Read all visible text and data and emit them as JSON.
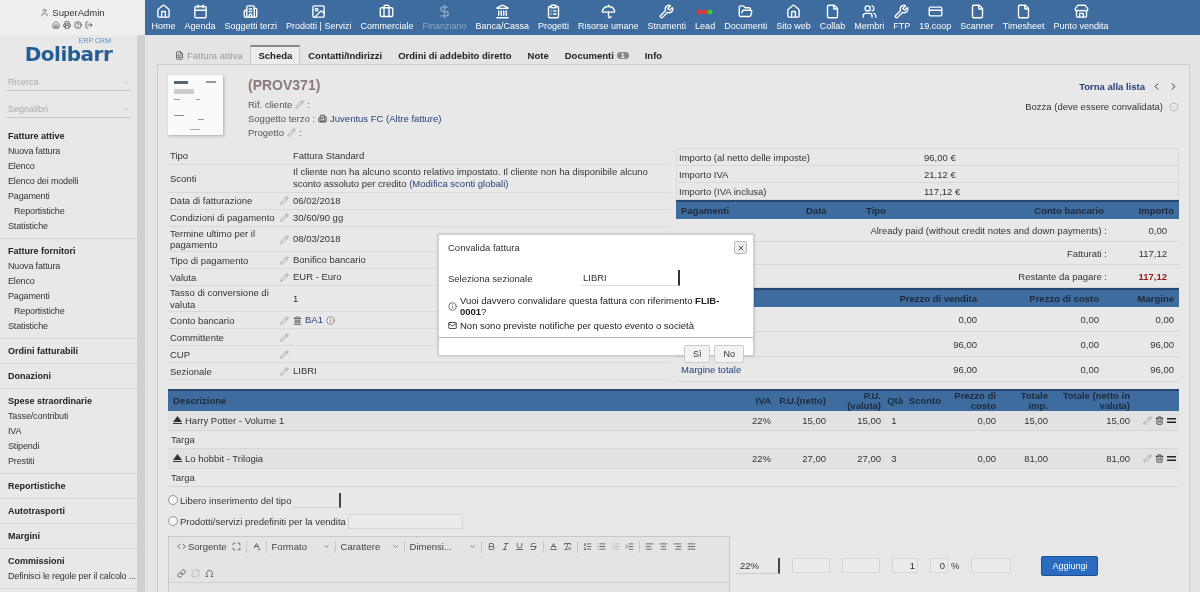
{
  "user": {
    "name": "SuperAdmin"
  },
  "nav": [
    {
      "label": "Home",
      "disabled": false
    },
    {
      "label": "Agenda",
      "disabled": false
    },
    {
      "label": "Soggetti terzi",
      "disabled": false
    },
    {
      "label": "Prodotti | Servizi",
      "disabled": false
    },
    {
      "label": "Commerciale",
      "disabled": false
    },
    {
      "label": "Finanziario",
      "disabled": true
    },
    {
      "label": "Banca/Cassa",
      "disabled": false
    },
    {
      "label": "Progetti",
      "disabled": false
    },
    {
      "label": "Risorse umane",
      "disabled": false
    },
    {
      "label": "Strumenti",
      "disabled": false
    },
    {
      "label": "Lead",
      "disabled": false
    },
    {
      "label": "Documenti",
      "disabled": false
    },
    {
      "label": "Sito web",
      "disabled": false
    },
    {
      "label": "Collab",
      "disabled": false
    },
    {
      "label": "Membri",
      "disabled": false
    },
    {
      "label": "FTP",
      "disabled": false
    },
    {
      "label": "19.coop",
      "disabled": false
    },
    {
      "label": "Scanner",
      "disabled": false
    },
    {
      "label": "Timesheet",
      "disabled": false
    },
    {
      "label": "Punto vendita",
      "disabled": false
    }
  ],
  "logo": {
    "name": "Dolibarr",
    "tagline": "ERP CRM"
  },
  "search": {
    "placeholder": "Ricerca"
  },
  "bookmarks": {
    "placeholder": "Segnalibri"
  },
  "menu": [
    {
      "title": "Fatture attive",
      "items": [
        {
          "label": "Nuova fattura"
        },
        {
          "label": "Elenco"
        },
        {
          "label": "Elenco dei modelli"
        },
        {
          "label": "Pagamenti",
          "children": [
            {
              "label": "Reportistiche"
            }
          ]
        },
        {
          "label": "Statistiche"
        }
      ]
    },
    {
      "title": "Fatture fornitori",
      "items": [
        {
          "label": "Nuova fattura"
        },
        {
          "label": "Elenco"
        },
        {
          "label": "Pagamenti",
          "children": [
            {
              "label": "Reportistiche"
            }
          ]
        },
        {
          "label": "Statistiche"
        }
      ]
    },
    {
      "title": "Ordini fatturabili"
    },
    {
      "title": "Donazioni"
    },
    {
      "title": "Spese straordinarie",
      "items": [
        {
          "label": "Tasse/contributi"
        },
        {
          "label": "IVA"
        },
        {
          "label": "Stipendi"
        },
        {
          "label": "Prestiti"
        }
      ]
    },
    {
      "title": "Reportistiche"
    },
    {
      "title": "Autotrasporti"
    },
    {
      "title": "Margini"
    },
    {
      "title": "Commissioni",
      "items": [
        {
          "label": "Definisci le regole per il calcolo ..."
        }
      ]
    }
  ],
  "tabs": [
    {
      "label": "Fattura attiva",
      "kind": "title",
      "selected": false
    },
    {
      "label": "Scheda",
      "kind": "tab",
      "selected": true
    },
    {
      "label": "Contatti/Indirizzi",
      "kind": "tab",
      "selected": false
    },
    {
      "label": "Ordini di addebito diretto",
      "kind": "tab",
      "selected": false
    },
    {
      "label": "Note",
      "kind": "tab",
      "selected": false
    },
    {
      "label": "Documenti",
      "kind": "tab",
      "selected": false,
      "badge": "1"
    },
    {
      "label": "Info",
      "kind": "tab",
      "selected": false
    }
  ],
  "invoice": {
    "ref": "(PROV371)",
    "fields": [
      {
        "label": "Rif. cliente",
        "editable": true,
        "suffix": ":"
      },
      {
        "label": "Soggetto terzo :",
        "editable": false,
        "link": "Juventus FC (Altre fatture)"
      },
      {
        "label": "Progetto",
        "editable": true,
        "suffix": ":"
      }
    ],
    "back_link": "Torna alla lista",
    "status": "Bozza (deve essere convalidata)"
  },
  "details": [
    {
      "label": "Tipo",
      "editable": false,
      "kind": "text",
      "value": "Fattura Standard"
    },
    {
      "label": "Sconti",
      "editable": false,
      "kind": "discount",
      "value": "Il cliente non ha alcuno sconto relativo impostato. Il cliente non ha disponibile alcuno sconto assoluto per credito",
      "link": "(Modifica sconti globali)"
    },
    {
      "label": "Data di fatturazione",
      "editable": true,
      "kind": "text",
      "value": "06/02/2018"
    },
    {
      "label": "Condizioni di pagamento",
      "editable": true,
      "kind": "text",
      "value": "30/60/90 gg"
    },
    {
      "label": "Termine ultimo per il pagamento",
      "editable": true,
      "kind": "text",
      "value": "08/03/2018"
    },
    {
      "label": "Tipo di pagamento",
      "editable": true,
      "kind": "text",
      "value": "Bonifico bancario"
    },
    {
      "label": "Valuta",
      "editable": true,
      "kind": "text",
      "value": "EUR - Euro"
    },
    {
      "label": "Tasso di conversione di valuta",
      "editable": false,
      "kind": "text",
      "value": "1"
    },
    {
      "label": "Conto bancario",
      "editable": true,
      "kind": "bank",
      "value": "BA1"
    },
    {
      "label": "Committente",
      "editable": true,
      "kind": "text"
    },
    {
      "label": "CUP",
      "editable": true,
      "kind": "text"
    },
    {
      "label": "Sezionale",
      "editable": true,
      "kind": "text",
      "value": "LIBRI"
    }
  ],
  "amounts": [
    {
      "label": "Importo (al netto delle imposte)",
      "value": "96,00 €"
    },
    {
      "label": "Importo IVA",
      "value": "21,12 €"
    },
    {
      "label": "Importo (IVA inclusa)",
      "value": "117,12 €"
    }
  ],
  "payments": {
    "columns": [
      "Pagamenti",
      "Data",
      "Tipo",
      "Conto bancario",
      "Importo"
    ],
    "rows": [
      {
        "label": "Already paid (without credit notes and down payments) :",
        "value": "0,00",
        "emphasis": false
      },
      {
        "label": "Fatturati :",
        "value": "117,12",
        "emphasis": false
      },
      {
        "label": "Restante da pagare :",
        "value": "117,12",
        "emphasis": true
      }
    ]
  },
  "margins": {
    "columns": [
      "Prezzo di vendita",
      "Prezzo di costo",
      "Margine"
    ],
    "rows": [
      {
        "values": [
          "0,00",
          "0,00",
          "0,00"
        ]
      },
      {
        "values": [
          "96,00",
          "0,00",
          "96,00"
        ]
      },
      {
        "label": "Margine totale",
        "values": [
          "96,00",
          "0,00",
          "96,00"
        ]
      }
    ]
  },
  "lines": {
    "columns": [
      "Descrizione",
      "IVA",
      "P.U.(netto)",
      "P.U. (valuta)",
      "Qtà",
      "Sconto",
      "Prezzo di costo",
      "Totale imp.",
      "Totale (netto in valuta)"
    ],
    "rows": [
      {
        "description": "Harry Potter - Volume 1",
        "vat": "22%",
        "price": "15,00",
        "price_currency": "15,00",
        "qty": "1",
        "cost": "0,00",
        "total": "15,00",
        "total_currency": "15,00",
        "note": "Targa"
      },
      {
        "description": "Lo hobbit - Trilogia",
        "vat": "22%",
        "price": "27,00",
        "price_currency": "27,00",
        "qty": "3",
        "cost": "0,00",
        "total": "81,00",
        "total_currency": "81,00",
        "note": "Targa"
      }
    ]
  },
  "add_form": {
    "options": [
      {
        "label": "Libero inserimento del tipo",
        "kind": "select",
        "selected": false
      },
      {
        "label": "Prodotti/servizi predefiniti per la vendita",
        "kind": "input",
        "selected": false
      }
    ],
    "source_button": "Sorgente",
    "dropdowns": [
      "Formato",
      "Carattere",
      "Dimensi..."
    ],
    "vat": "22%",
    "qty": "1",
    "discount": "0",
    "percent": "%",
    "submit": "Aggiungi"
  },
  "modal": {
    "title": "Convalida fattura",
    "field_label": "Seleziona sezionale",
    "field_value": "LIBRI",
    "question": "Vuoi davvero convalidare questa fattura con riferimento **FLIB-0001**?",
    "notice": "Non sono previste notifiche per questo evento o società",
    "buttons": [
      "Sì",
      "No"
    ]
  }
}
